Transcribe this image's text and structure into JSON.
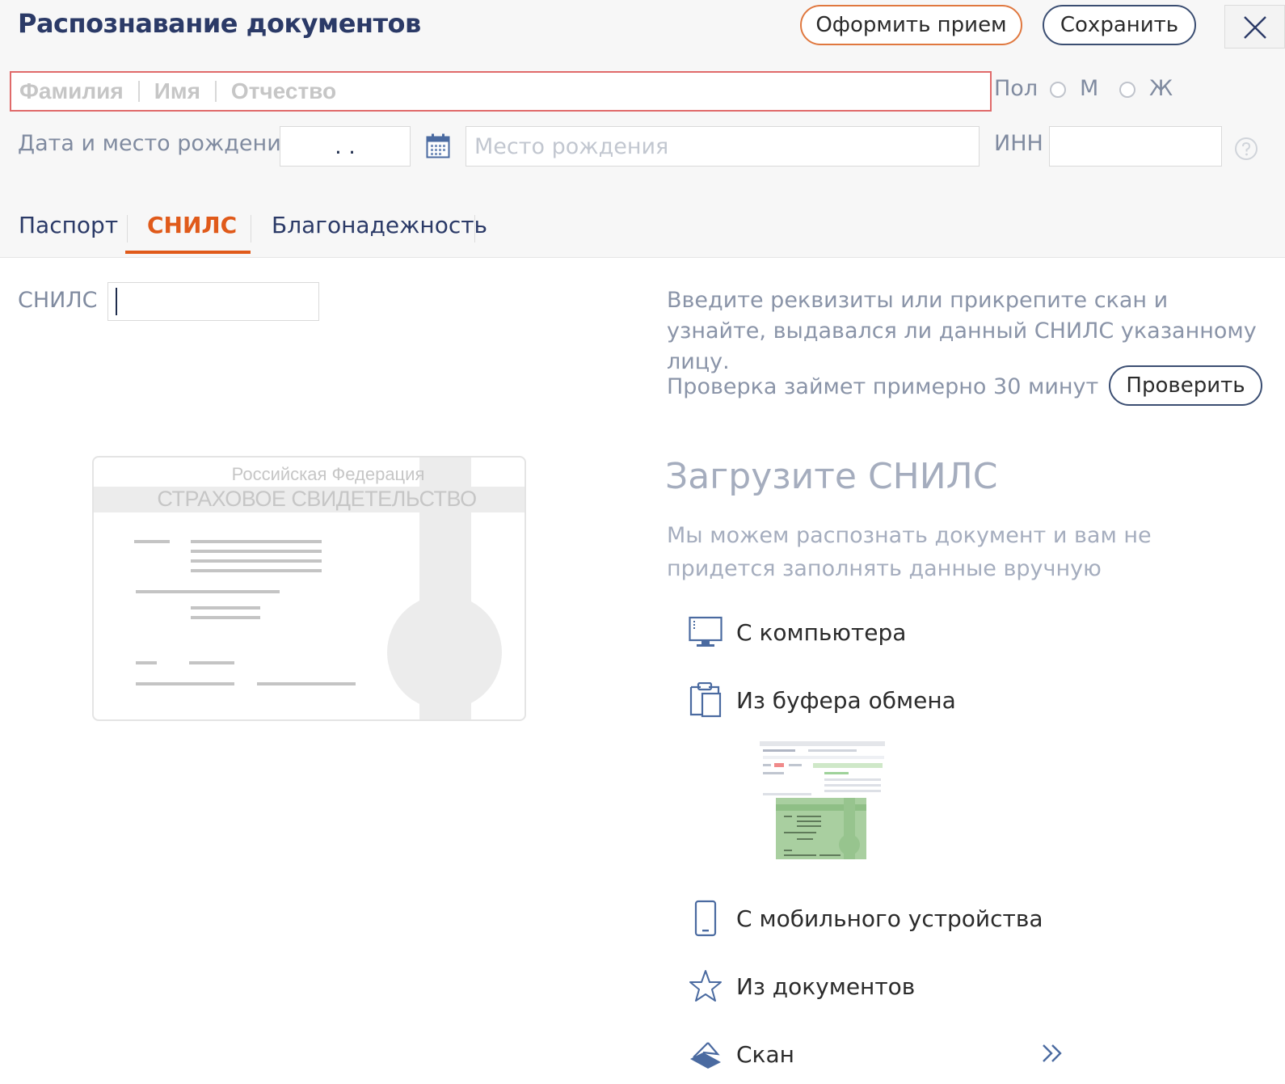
{
  "header": {
    "title": "Распознавание документов",
    "admit_button": "Оформить прием",
    "save_button": "Сохранить"
  },
  "name": {
    "last_name": "Фамилия",
    "first_name": "Имя",
    "patronymic": "Отчество"
  },
  "gender": {
    "label": "Пол",
    "male": "М",
    "female": "Ж"
  },
  "birth": {
    "label": "Дата и место рождения",
    "date_value": ". .",
    "place_placeholder": "Место рождения"
  },
  "inn": {
    "label": "ИНН",
    "value": ""
  },
  "tabs": [
    {
      "label": "Паспорт",
      "active": false
    },
    {
      "label": "СНИЛС",
      "active": true
    },
    {
      "label": "Благонадежность",
      "active": false
    }
  ],
  "snils": {
    "label": "СНИЛС",
    "value": ""
  },
  "check": {
    "description": "Введите реквизиты или прикрепите скан и узнайте, выдавался ли данный СНИЛС указанному лицу.",
    "duration": "Проверка займет примерно 30 минут",
    "button": "Проверить"
  },
  "card": {
    "country": "Российская Федерация",
    "doc_title": "СТРАХОВОЕ СВИДЕТЕЛЬСТВО"
  },
  "upload": {
    "heading": "Загрузите СНИЛС",
    "subheading": "Мы можем распознать документ и вам не придется заполнять данные вручную",
    "items": [
      {
        "label": "С компьютера",
        "icon": "monitor-icon"
      },
      {
        "label": "Из буфера обмена",
        "icon": "clipboard-icon"
      },
      {
        "label": "С мобильного устройства",
        "icon": "phone-icon"
      },
      {
        "label": "Из документов",
        "icon": "star-icon"
      },
      {
        "label": "Скан",
        "icon": "scanner-icon"
      }
    ]
  },
  "colors": {
    "accent": "#e05a1a",
    "title": "#2b3a67",
    "error_border": "#e06a6a"
  }
}
